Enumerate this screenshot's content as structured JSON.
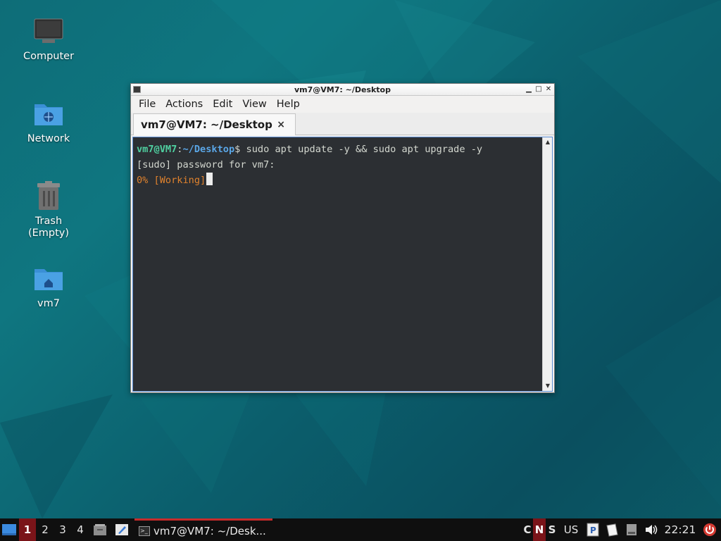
{
  "desktop": {
    "icons": [
      {
        "label": "Computer",
        "icon": "computer-icon"
      },
      {
        "label": "Network",
        "icon": "network-folder-icon"
      },
      {
        "label": "Trash",
        "sublabel": "(Empty)",
        "icon": "trash-icon"
      },
      {
        "label": "vm7",
        "icon": "home-folder-icon"
      }
    ]
  },
  "window": {
    "title": "vm7@VM7: ~/Desktop",
    "menu": [
      "File",
      "Actions",
      "Edit",
      "View",
      "Help"
    ],
    "tab": {
      "label": "vm7@VM7: ~/Desktop",
      "close": "×"
    },
    "terminal": {
      "prompt_user": "vm7@VM7",
      "prompt_colon": ":",
      "prompt_path": "~/Desktop",
      "prompt_symbol": "$",
      "command": " sudo apt update -y && sudo apt upgrade -y",
      "line2": "[sudo] password for vm7:",
      "line3": "0% [Working]"
    },
    "controls": {
      "minimize": "▁",
      "maximize": "□",
      "close": "✕"
    }
  },
  "taskbar": {
    "workspaces": [
      "1",
      "2",
      "3",
      "4"
    ],
    "active_workspace": "1",
    "task_label": "vm7@VM7: ~/Desk...",
    "indicators": [
      "C",
      "N",
      "S"
    ],
    "keyboard_layout": "US",
    "clock": "22:21"
  },
  "colors": {
    "accent_red": "#7a1419",
    "prompt_green": "#4fd0a0",
    "prompt_blue": "#5aa6e6",
    "working_orange": "#e0822d"
  }
}
